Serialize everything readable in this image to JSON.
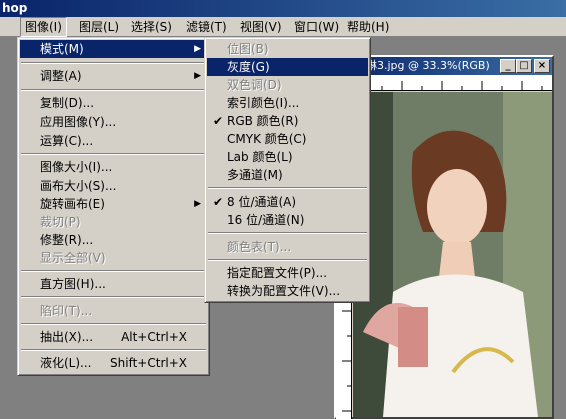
{
  "app_title": "hop",
  "menubar": [
    {
      "label": "图像(I)",
      "active": true
    },
    {
      "label": "图层(L)"
    },
    {
      "label": "选择(S)"
    },
    {
      "label": "滤镜(T)"
    },
    {
      "label": "视图(V)"
    },
    {
      "label": "窗口(W)"
    },
    {
      "label": "帮助(H)"
    }
  ],
  "image_menu": {
    "items": [
      {
        "label": "模式(M)",
        "submenu": true,
        "selected": true
      },
      {
        "label": "调整(A)",
        "submenu": true
      },
      {
        "label": "复制(D)..."
      },
      {
        "label": "应用图像(Y)..."
      },
      {
        "label": "运算(C)..."
      },
      {
        "label": "图像大小(I)..."
      },
      {
        "label": "画布大小(S)..."
      },
      {
        "label": "旋转画布(E)",
        "submenu": true
      },
      {
        "label": "裁切(P)",
        "disabled": true
      },
      {
        "label": "修整(R)..."
      },
      {
        "label": "显示全部(V)",
        "disabled": true
      },
      {
        "label": "直方图(H)..."
      },
      {
        "label": "陷印(T)...",
        "disabled": true
      },
      {
        "label": "抽出(X)...",
        "shortcut": "Alt+Ctrl+X"
      },
      {
        "label": "液化(L)...",
        "shortcut": "Shift+Ctrl+X"
      }
    ]
  },
  "mode_menu": {
    "items": [
      {
        "label": "位图(B)",
        "disabled": true
      },
      {
        "label": "灰度(G)",
        "selected": true
      },
      {
        "label": "双色调(D)",
        "disabled": true
      },
      {
        "label": "索引颜色(I)..."
      },
      {
        "label": "RGB 颜色(R)",
        "checked": true
      },
      {
        "label": "CMYK 颜色(C)"
      },
      {
        "label": "Lab 颜色(L)"
      },
      {
        "label": "多通道(M)"
      },
      {
        "label": "8 位/通道(A)",
        "checked": true
      },
      {
        "label": "16 位/通道(N)"
      },
      {
        "label": "颜色表(T)...",
        "disabled": true
      },
      {
        "label": "指定配置文件(P)..."
      },
      {
        "label": "转换为配置文件(V)..."
      }
    ]
  },
  "document": {
    "title": "琳3.jpg @ 33.3%(RGB)",
    "buttons": [
      "_",
      "□",
      "×"
    ]
  },
  "colors": {
    "selection": "#0a246a",
    "menu_bg": "#d4d0c8",
    "workspace": "#808080"
  }
}
